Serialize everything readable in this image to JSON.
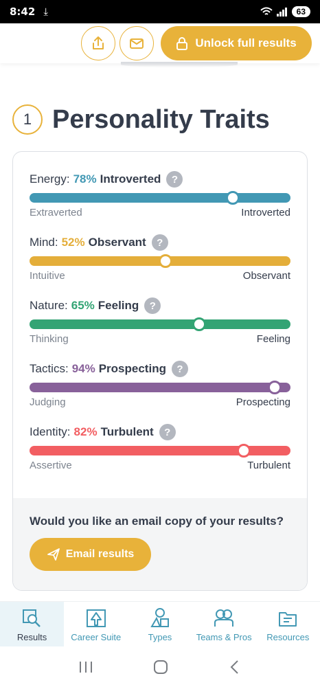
{
  "status": {
    "time": "8:42",
    "battery": "63"
  },
  "header": {
    "unlock_label": "Unlock full results"
  },
  "section": {
    "number": "1",
    "title": "Personality Traits"
  },
  "colors": {
    "accent": "#e8b23a",
    "energy": "#4298b4",
    "mind": "#e4ae3a",
    "nature": "#33a474",
    "tactics": "#88619a",
    "identity": "#f25e62",
    "help": "#b3b7bf"
  },
  "traits": [
    {
      "category": "Energy:",
      "percent": "78%",
      "result": "Introverted",
      "value": 78,
      "left": "Extraverted",
      "right": "Introverted",
      "color": "#4298b4"
    },
    {
      "category": "Mind:",
      "percent": "52%",
      "result": "Observant",
      "value": 52,
      "left": "Intuitive",
      "right": "Observant",
      "color": "#e4ae3a"
    },
    {
      "category": "Nature:",
      "percent": "65%",
      "result": "Feeling",
      "value": 65,
      "left": "Thinking",
      "right": "Feeling",
      "color": "#33a474"
    },
    {
      "category": "Tactics:",
      "percent": "94%",
      "result": "Prospecting",
      "value": 94,
      "left": "Judging",
      "right": "Prospecting",
      "color": "#88619a"
    },
    {
      "category": "Identity:",
      "percent": "82%",
      "result": "Turbulent",
      "value": 82,
      "left": "Assertive",
      "right": "Turbulent",
      "color": "#f25e62"
    }
  ],
  "help_glyph": "?",
  "email": {
    "question": "Would you like an email copy of your results?",
    "button": "Email results"
  },
  "nav": [
    {
      "label": "Results",
      "icon": "results-icon"
    },
    {
      "label": "Career Suite",
      "icon": "career-icon"
    },
    {
      "label": "Types",
      "icon": "types-icon"
    },
    {
      "label": "Teams & Pros",
      "icon": "teams-icon"
    },
    {
      "label": "Resources",
      "icon": "resources-icon"
    }
  ]
}
